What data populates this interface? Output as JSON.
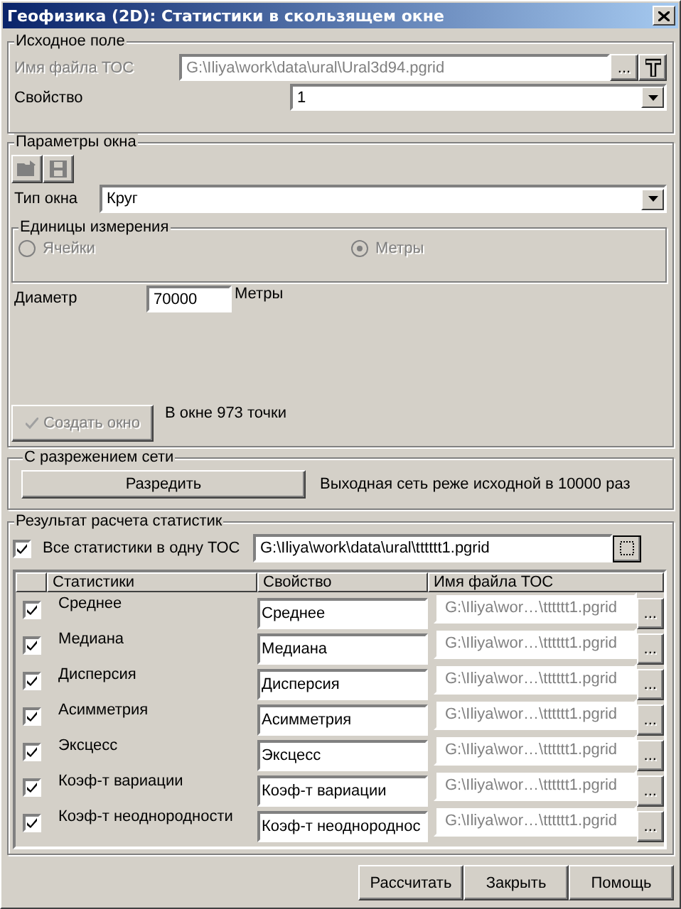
{
  "window": {
    "title": "Геофизика (2D): Статистики в скользящем окне"
  },
  "source": {
    "legend": "Исходное поле",
    "file_label": "Имя файла ТОС",
    "file_value": "G:\\Iliya\\work\\data\\ural\\Ural3d94.pgrid",
    "file_disabled": true,
    "browse": "...",
    "property_label": "Свойство",
    "property_value": "1"
  },
  "params": {
    "legend": "Параметры окна",
    "type_label": "Тип окна",
    "type_value": "Круг",
    "units": {
      "legend": "Единицы измерения",
      "options": [
        {
          "label": "Ячейки",
          "selected": false,
          "disabled": true
        },
        {
          "label": "Метры",
          "selected": true,
          "disabled": true
        }
      ]
    },
    "diameter_label": "Диаметр",
    "diameter_value": "70000",
    "diameter_unit": "Метры",
    "create_button": {
      "label": "Создать окно",
      "disabled": true
    },
    "info": "В окне 973 точки"
  },
  "thinning": {
    "legend": "С разрежением сети",
    "button": "Разредить",
    "info": "Выходная сеть реже исходной в 10000 раз"
  },
  "results": {
    "legend": "Результат расчета статистик",
    "all_in_one": {
      "label": "Все статистики в одну ТОС",
      "checked": true
    },
    "file_value": "G:\\Iliya\\work\\data\\ural\\tttttt1.pgrid",
    "columns": [
      "Статистики",
      "Свойство",
      "Имя файла ТОС"
    ],
    "rows": [
      {
        "checked": true,
        "name": "Среднее",
        "property": "Среднее",
        "file": "G:\\Iliya\\wor…\\tttttt1.pgrid",
        "file_disabled": true,
        "browse": "..."
      },
      {
        "checked": true,
        "name": "Медиана",
        "property": "Медиана",
        "file": "G:\\Iliya\\wor…\\tttttt1.pgrid",
        "file_disabled": true,
        "browse": "..."
      },
      {
        "checked": true,
        "name": "Дисперсия",
        "property": "Дисперсия",
        "file": "G:\\Iliya\\wor…\\tttttt1.pgrid",
        "file_disabled": true,
        "browse": "..."
      },
      {
        "checked": true,
        "name": "Асимметрия",
        "property": "Асимметрия",
        "file": "G:\\Iliya\\wor…\\tttttt1.pgrid",
        "file_disabled": true,
        "browse": "..."
      },
      {
        "checked": true,
        "name": "Эксцесс",
        "property": "Эксцесс",
        "file": "G:\\Iliya\\wor…\\tttttt1.pgrid",
        "file_disabled": true,
        "browse": "..."
      },
      {
        "checked": true,
        "name": "Коэф-т вариации",
        "property": "Коэф-т вариации",
        "file": "G:\\Iliya\\wor…\\tttttt1.pgrid",
        "file_disabled": true,
        "browse": "..."
      },
      {
        "checked": true,
        "name": "Коэф-т неоднородности",
        "property": "Коэф-т неоднороднос",
        "file": "G:\\Iliya\\wor…\\tttttt1.pgrid",
        "file_disabled": true,
        "browse": "..."
      }
    ]
  },
  "buttons": [
    "Рассчитать",
    "Закрыть",
    "Помощь"
  ]
}
